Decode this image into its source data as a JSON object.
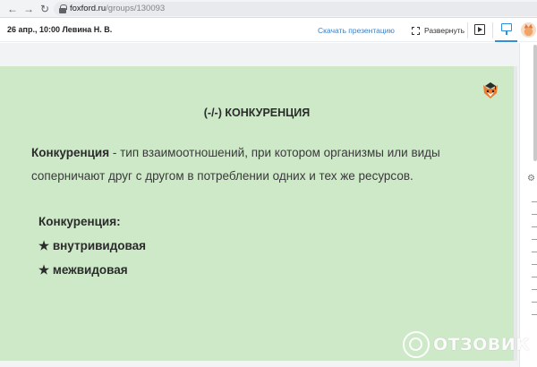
{
  "browser": {
    "url_host": "foxford.ru",
    "url_path": "/groups/130093"
  },
  "header": {
    "lesson_info": "26 апр., 10:00 Левина Н. В.",
    "download_label": "Скачать презентацию",
    "expand_label": "Развернуть"
  },
  "slide": {
    "title": "(-/-) КОНКУРЕНЦИЯ",
    "term": "Конкуренция",
    "definition_rest": " - тип взаимоотношений, при котором организмы или виды соперничают друг с другом в потреблении одних и тех же ресурсов.",
    "list_heading": "Конкуренция:",
    "list_items": [
      "★ внутривидовая",
      "★ межвидовая"
    ]
  },
  "colors": {
    "slide_background": "#cde9c8",
    "accent": "#2f8fd8",
    "link": "#3b82c6"
  },
  "icons": [
    "back-arrow-icon",
    "forward-arrow-icon",
    "reload-icon",
    "lock-icon",
    "expand-icon",
    "play-icon",
    "whiteboard-icon",
    "fox-logo-icon",
    "settings-icon"
  ],
  "watermark": {
    "text": "ОТЗОВИК"
  }
}
